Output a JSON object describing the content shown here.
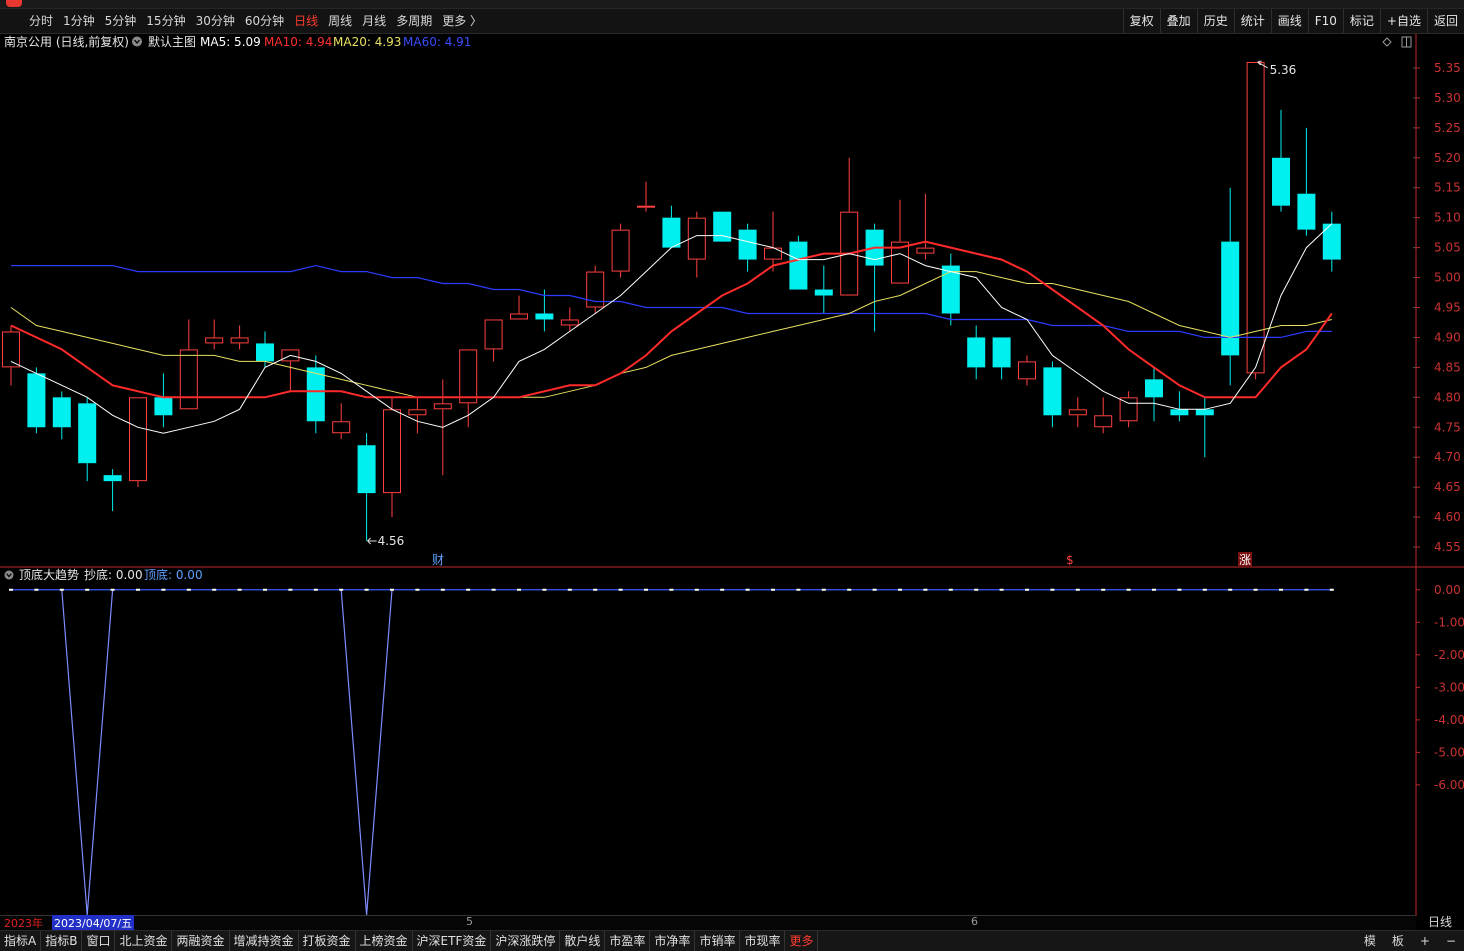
{
  "toolbar": {
    "periods": [
      {
        "label": "分时",
        "active": false
      },
      {
        "label": "1分钟",
        "active": false
      },
      {
        "label": "5分钟",
        "active": false
      },
      {
        "label": "15分钟",
        "active": false
      },
      {
        "label": "30分钟",
        "active": false
      },
      {
        "label": "60分钟",
        "active": false
      },
      {
        "label": "日线",
        "active": true
      },
      {
        "label": "周线",
        "active": false
      },
      {
        "label": "月线",
        "active": false
      },
      {
        "label": "多周期",
        "active": false
      },
      {
        "label": "更多 〉",
        "active": false
      }
    ],
    "tools": [
      "复权",
      "叠加",
      "历史",
      "统计",
      "画线",
      "F10",
      "标记",
      "+自选",
      "返回"
    ]
  },
  "main_header": {
    "stock": "南京公用 (日线,前复权)",
    "template": "默认主图",
    "ma5": "MA5: 5.09",
    "ma10": "MA10: 4.94",
    "ma20": "MA20: 4.93",
    "ma60": "MA60: 4.91"
  },
  "sub_header": {
    "name": "顶底大趋势",
    "buy": "抄底: 0.00",
    "top": "顶底: 0.00"
  },
  "markers": [
    "财",
    "$",
    "涨"
  ],
  "datebar": {
    "year": "2023年",
    "cursor_date": "2023/04/07/五",
    "month5": "5",
    "month6": "6"
  },
  "right_foot": "日线",
  "bottom_tabs": [
    "指标A",
    "指标B",
    "窗口",
    "北上资金",
    "两融资金",
    "增减持资金",
    "打板资金",
    "上榜资金",
    "沪深ETF资金",
    "沪深涨跌停",
    "散户线",
    "市盈率",
    "市净率",
    "市销率",
    "市现率",
    "更多"
  ],
  "bottom_right": [
    "模",
    "板",
    "+",
    "−"
  ],
  "colors": {
    "up": "#ff4040",
    "down": "#00f0f0",
    "ma5": "#ffffff",
    "ma10": "#ff2a2a",
    "ma20": "#e8e060",
    "ma60": "#2a3cff",
    "axis": "#c0282a"
  },
  "chart_data": [
    {
      "type": "candlestick",
      "title": "南京公用 (日线,前复权)",
      "ylim": [
        4.53,
        5.38
      ],
      "yticks": [
        "5.35",
        "5.30",
        "5.25",
        "5.20",
        "5.15",
        "5.10",
        "5.05",
        "5.00",
        "4.95",
        "4.90",
        "4.85",
        "4.80",
        "4.75",
        "4.70",
        "4.65",
        "4.60",
        "4.55"
      ],
      "high_label": "5.36",
      "low_label": "4.56",
      "candles": [
        {
          "o": 4.85,
          "h": 4.92,
          "l": 4.82,
          "c": 4.91
        },
        {
          "o": 4.84,
          "h": 4.85,
          "l": 4.74,
          "c": 4.75
        },
        {
          "o": 4.8,
          "h": 4.81,
          "l": 4.73,
          "c": 4.75
        },
        {
          "o": 4.79,
          "h": 4.8,
          "l": 4.66,
          "c": 4.69
        },
        {
          "o": 4.67,
          "h": 4.68,
          "l": 4.61,
          "c": 4.66
        },
        {
          "o": 4.66,
          "h": 4.8,
          "l": 4.65,
          "c": 4.8
        },
        {
          "o": 4.8,
          "h": 4.84,
          "l": 4.75,
          "c": 4.77
        },
        {
          "o": 4.78,
          "h": 4.93,
          "l": 4.78,
          "c": 4.88
        },
        {
          "o": 4.89,
          "h": 4.93,
          "l": 4.88,
          "c": 4.9
        },
        {
          "o": 4.89,
          "h": 4.92,
          "l": 4.88,
          "c": 4.9
        },
        {
          "o": 4.89,
          "h": 4.91,
          "l": 4.85,
          "c": 4.86
        },
        {
          "o": 4.86,
          "h": 4.88,
          "l": 4.81,
          "c": 4.88
        },
        {
          "o": 4.85,
          "h": 4.87,
          "l": 4.74,
          "c": 4.76
        },
        {
          "o": 4.74,
          "h": 4.79,
          "l": 4.73,
          "c": 4.76
        },
        {
          "o": 4.72,
          "h": 4.74,
          "l": 4.56,
          "c": 4.64
        },
        {
          "o": 4.64,
          "h": 4.8,
          "l": 4.6,
          "c": 4.78
        },
        {
          "o": 4.77,
          "h": 4.8,
          "l": 4.74,
          "c": 4.78
        },
        {
          "o": 4.78,
          "h": 4.83,
          "l": 4.67,
          "c": 4.79
        },
        {
          "o": 4.79,
          "h": 4.88,
          "l": 4.75,
          "c": 4.88
        },
        {
          "o": 4.88,
          "h": 4.93,
          "l": 4.86,
          "c": 4.93
        },
        {
          "o": 4.93,
          "h": 4.97,
          "l": 4.93,
          "c": 4.94
        },
        {
          "o": 4.94,
          "h": 4.98,
          "l": 4.91,
          "c": 4.93
        },
        {
          "o": 4.92,
          "h": 4.95,
          "l": 4.91,
          "c": 4.93
        },
        {
          "o": 4.95,
          "h": 5.02,
          "l": 4.94,
          "c": 5.01
        },
        {
          "o": 5.01,
          "h": 5.09,
          "l": 5.0,
          "c": 5.08
        },
        {
          "o": 5.12,
          "h": 5.16,
          "l": 5.11,
          "c": 5.12
        },
        {
          "o": 5.1,
          "h": 5.12,
          "l": 5.05,
          "c": 5.05
        },
        {
          "o": 5.03,
          "h": 5.11,
          "l": 5.0,
          "c": 5.1
        },
        {
          "o": 5.11,
          "h": 5.11,
          "l": 5.06,
          "c": 5.06
        },
        {
          "o": 5.08,
          "h": 5.09,
          "l": 5.01,
          "c": 5.03
        },
        {
          "o": 5.03,
          "h": 5.11,
          "l": 5.01,
          "c": 5.05
        },
        {
          "o": 5.06,
          "h": 5.07,
          "l": 4.98,
          "c": 4.98
        },
        {
          "o": 4.98,
          "h": 5.02,
          "l": 4.94,
          "c": 4.97
        },
        {
          "o": 4.97,
          "h": 5.2,
          "l": 4.97,
          "c": 5.11
        },
        {
          "o": 5.08,
          "h": 5.09,
          "l": 4.91,
          "c": 5.02
        },
        {
          "o": 4.99,
          "h": 5.13,
          "l": 4.99,
          "c": 5.06
        },
        {
          "o": 5.04,
          "h": 5.14,
          "l": 5.03,
          "c": 5.05
        },
        {
          "o": 5.02,
          "h": 5.04,
          "l": 4.92,
          "c": 4.94
        },
        {
          "o": 4.9,
          "h": 4.92,
          "l": 4.83,
          "c": 4.85
        },
        {
          "o": 4.9,
          "h": 4.9,
          "l": 4.83,
          "c": 4.85
        },
        {
          "o": 4.83,
          "h": 4.87,
          "l": 4.82,
          "c": 4.86
        },
        {
          "o": 4.85,
          "h": 4.86,
          "l": 4.75,
          "c": 4.77
        },
        {
          "o": 4.77,
          "h": 4.8,
          "l": 4.75,
          "c": 4.78
        },
        {
          "o": 4.75,
          "h": 4.8,
          "l": 4.74,
          "c": 4.77
        },
        {
          "o": 4.76,
          "h": 4.81,
          "l": 4.75,
          "c": 4.8
        },
        {
          "o": 4.83,
          "h": 4.85,
          "l": 4.76,
          "c": 4.8
        },
        {
          "o": 4.78,
          "h": 4.81,
          "l": 4.76,
          "c": 4.77
        },
        {
          "o": 4.78,
          "h": 4.8,
          "l": 4.7,
          "c": 4.77
        },
        {
          "o": 5.06,
          "h": 5.15,
          "l": 4.82,
          "c": 4.87
        },
        {
          "o": 4.84,
          "h": 5.36,
          "l": 4.83,
          "c": 5.36
        },
        {
          "o": 5.2,
          "h": 5.28,
          "l": 5.11,
          "c": 5.12
        },
        {
          "o": 5.14,
          "h": 5.25,
          "l": 5.07,
          "c": 5.08
        },
        {
          "o": 5.09,
          "h": 5.11,
          "l": 5.01,
          "c": 5.03
        }
      ],
      "ma": {
        "ma5": [
          4.86,
          4.84,
          4.82,
          4.8,
          4.77,
          4.75,
          4.74,
          4.75,
          4.76,
          4.78,
          4.85,
          4.87,
          4.86,
          4.84,
          4.81,
          4.78,
          4.76,
          4.75,
          4.77,
          4.8,
          4.86,
          4.88,
          4.91,
          4.94,
          4.97,
          5.01,
          5.05,
          5.07,
          5.07,
          5.06,
          5.05,
          5.03,
          5.03,
          5.04,
          5.03,
          5.04,
          5.02,
          5.01,
          5.0,
          4.95,
          4.93,
          4.87,
          4.84,
          4.81,
          4.79,
          4.79,
          4.78,
          4.78,
          4.79,
          4.85,
          4.97,
          5.05,
          5.09
        ],
        "ma10": [
          4.92,
          4.9,
          4.88,
          4.85,
          4.82,
          4.81,
          4.8,
          4.8,
          4.8,
          4.8,
          4.8,
          4.81,
          4.81,
          4.81,
          4.8,
          4.8,
          4.8,
          4.8,
          4.8,
          4.8,
          4.8,
          4.81,
          4.82,
          4.82,
          4.84,
          4.87,
          4.91,
          4.94,
          4.97,
          4.99,
          5.02,
          5.03,
          5.04,
          5.04,
          5.05,
          5.05,
          5.06,
          5.05,
          5.04,
          5.03,
          5.01,
          4.98,
          4.95,
          4.92,
          4.88,
          4.85,
          4.82,
          4.8,
          4.8,
          4.8,
          4.85,
          4.88,
          4.94
        ],
        "ma20": [
          4.95,
          4.92,
          4.91,
          4.9,
          4.89,
          4.88,
          4.87,
          4.87,
          4.87,
          4.86,
          4.86,
          4.85,
          4.84,
          4.83,
          4.82,
          4.81,
          4.8,
          4.8,
          4.8,
          4.8,
          4.8,
          4.8,
          4.81,
          4.82,
          4.84,
          4.85,
          4.87,
          4.88,
          4.89,
          4.9,
          4.91,
          4.92,
          4.93,
          4.94,
          4.96,
          4.97,
          4.99,
          5.01,
          5.01,
          5.0,
          4.99,
          4.99,
          4.98,
          4.97,
          4.96,
          4.94,
          4.92,
          4.91,
          4.9,
          4.91,
          4.92,
          4.92,
          4.93
        ],
        "ma60": [
          5.02,
          5.02,
          5.02,
          5.02,
          5.02,
          5.01,
          5.01,
          5.01,
          5.01,
          5.01,
          5.01,
          5.01,
          5.02,
          5.01,
          5.01,
          5.0,
          5.0,
          4.99,
          4.99,
          4.98,
          4.98,
          4.97,
          4.97,
          4.96,
          4.96,
          4.95,
          4.95,
          4.95,
          4.95,
          4.94,
          4.94,
          4.94,
          4.94,
          4.94,
          4.94,
          4.94,
          4.94,
          4.93,
          4.93,
          4.93,
          4.93,
          4.92,
          4.92,
          4.92,
          4.91,
          4.91,
          4.91,
          4.9,
          4.9,
          4.9,
          4.9,
          4.91,
          4.91
        ]
      }
    },
    {
      "type": "line",
      "title": "顶底大趋势",
      "ylim": [
        -10.0,
        0.3
      ],
      "yticks": [
        "0.00",
        "-1.00",
        "-2.00",
        "-3.00",
        "-4.00",
        "-5.00",
        "-6.00"
      ],
      "series": [
        {
          "name": "抄底",
          "values": [
            0,
            0,
            0,
            -10,
            0,
            0,
            0,
            0,
            0,
            0,
            0,
            0,
            0,
            0,
            -10,
            0,
            0,
            0,
            0,
            0,
            0,
            0,
            0,
            0,
            0,
            0,
            0,
            0,
            0,
            0,
            0,
            0,
            0,
            0,
            0,
            0,
            0,
            0,
            0,
            0,
            0,
            0,
            0,
            0,
            0,
            0,
            0,
            0,
            0,
            0,
            0,
            0,
            0
          ]
        }
      ]
    }
  ]
}
